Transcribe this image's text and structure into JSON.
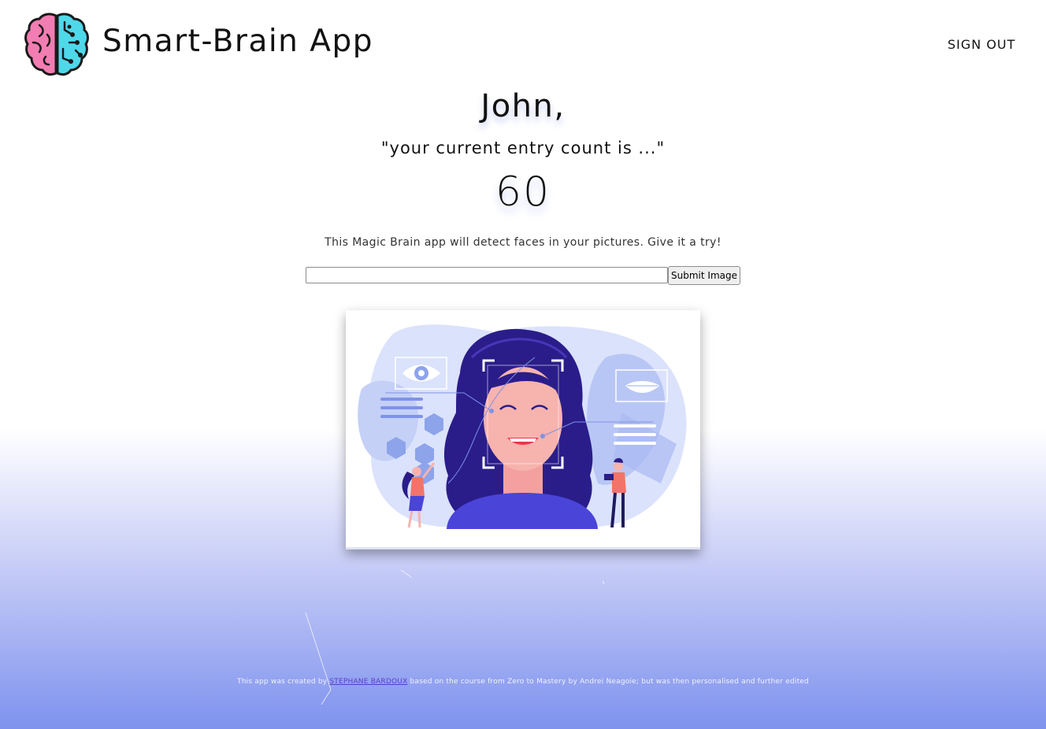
{
  "header": {
    "app_title": "Smart-Brain App",
    "sign_out_label": "SIGN OUT",
    "logo_icon": "brain-icon"
  },
  "profile": {
    "greeting": "John,",
    "entry_text": "\"your current entry count is ...\"",
    "entry_count": "60"
  },
  "main": {
    "description": "This Magic Brain app will detect faces in your pictures. Give it a try!",
    "url_input_value": "",
    "submit_label": "Submit Image",
    "illustration_icon": "face-recognition-illustration"
  },
  "footer": {
    "text_before": "This app was created by ",
    "author_link": "STEPHANE BARDOUX",
    "text_after": " based on the course from Zero to Mastery by Andrei Neagoie; but was then personalised and further edited"
  },
  "colors": {
    "accent": "#3a3fd6",
    "gradient_bottom": "#7e92ee",
    "brain_left": "#f27db2",
    "brain_right": "#4fd8ea"
  }
}
